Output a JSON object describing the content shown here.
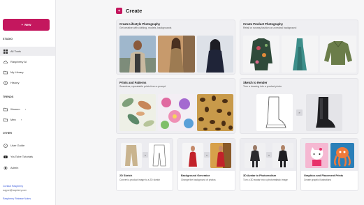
{
  "sidebar": {
    "new_button": "New",
    "studio_label": "STUDIO",
    "studio_items": [
      {
        "label": "All Tools",
        "icon": "grid-icon"
      },
      {
        "label": "Raspberry AI",
        "icon": "cloud-icon"
      },
      {
        "label": "My Library",
        "icon": "folder-icon"
      },
      {
        "label": "History",
        "icon": "history-icon"
      }
    ],
    "trends_label": "TRENDS",
    "trend_items": [
      {
        "label": "Women",
        "icon": "folder-icon"
      },
      {
        "label": "Men",
        "icon": "folder-icon"
      }
    ],
    "other_label": "OTHER",
    "other_items": [
      {
        "label": "User Guide",
        "icon": "help-icon"
      },
      {
        "label": "YouTube Tutorials",
        "icon": "youtube-icon"
      },
      {
        "label": "Admin",
        "icon": "admin-icon"
      }
    ],
    "contact_link": "Contact Raspberry",
    "contact_email": "support@raspberry.com",
    "release_notes": "Raspberry Release Notes"
  },
  "header": {
    "title": "Create"
  },
  "cards": {
    "lifestyle": {
      "title": "Create Lifestyle Photography",
      "subtitle": "Get creative with clothing, models, backgrounds"
    },
    "product": {
      "title": "Create Product Photography",
      "subtitle": "Retail or runway fashion on a neutral background"
    },
    "prints": {
      "title": "Prints and Patterns",
      "subtitle": "Seamless, repeatable prints from a prompt"
    },
    "sketch": {
      "title": "Sketch to Render",
      "subtitle": "Turn a drawing into a product photo"
    },
    "sketch2d": {
      "title": "2D Sketch",
      "subtitle": "Convert a product image to a 2D sketch"
    },
    "bggen": {
      "title": "Background Generator",
      "subtitle": "Change the background of photos"
    },
    "avatar": {
      "title": "3D Avatar to Photorealism",
      "subtitle": "Turn a 3D avatar into a photorealistic image"
    },
    "graphics": {
      "title": "Graphics and Placement Prints",
      "subtitle": "Create graphic illustrations"
    }
  },
  "colors": {
    "accent": "#c4175e",
    "sidebar_bg": "#ffffff",
    "page_bg": "#f6f6f7"
  }
}
